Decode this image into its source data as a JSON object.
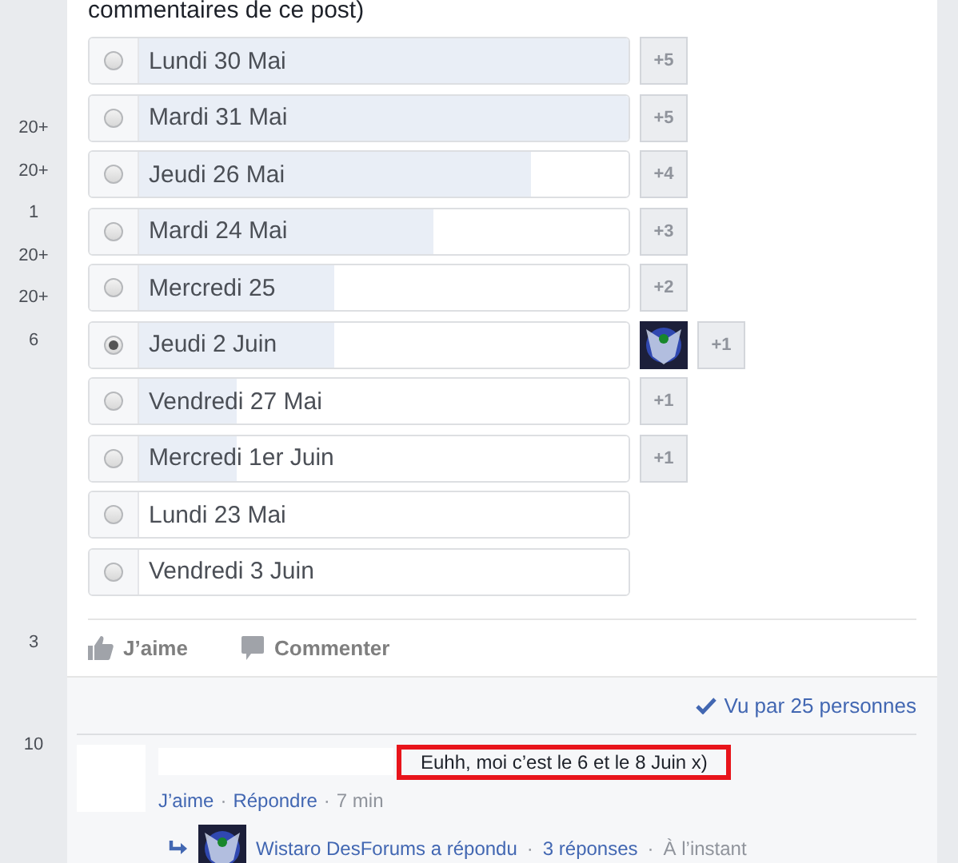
{
  "sidebar": {
    "upper_counts": [
      "20+",
      "20+",
      "1",
      "20+",
      "20+",
      "6"
    ],
    "lower_counts": [
      "3",
      "10"
    ]
  },
  "post": {
    "text_end": "commentaires de ce post)"
  },
  "poll": {
    "options": [
      {
        "label": "Lundi 30 Mai",
        "selected": false,
        "level": 1,
        "voter_avatar": false,
        "more": "+5"
      },
      {
        "label": "Mardi 31 Mai",
        "selected": false,
        "level": 1,
        "voter_avatar": false,
        "more": "+5"
      },
      {
        "label": "Jeudi 26 Mai",
        "selected": false,
        "level": 0.8,
        "voter_avatar": false,
        "more": "+4"
      },
      {
        "label": "Mardi 24 Mai",
        "selected": false,
        "level": 0.6,
        "voter_avatar": false,
        "more": "+3"
      },
      {
        "label": "Mercredi 25",
        "selected": false,
        "level": 0.4,
        "voter_avatar": false,
        "more": "+2"
      },
      {
        "label": "Jeudi 2 Juin",
        "selected": true,
        "level": 0.4,
        "voter_avatar": true,
        "more": "+1"
      },
      {
        "label": "Vendredi 27 Mai",
        "selected": false,
        "level": 0.2,
        "voter_avatar": false,
        "more": "+1"
      },
      {
        "label": "Mercredi 1er Juin",
        "selected": false,
        "level": 0.2,
        "voter_avatar": false,
        "more": "+1"
      },
      {
        "label": "Lundi 23 Mai",
        "selected": false,
        "voter_avatar": false
      },
      {
        "label": "Vendredi 3 Juin",
        "selected": false,
        "voter_avatar": false
      }
    ]
  },
  "actions": [
    "J’aime",
    "Commenter"
  ],
  "seen_by": "Vu par 25 personnes",
  "comment": {
    "text": "Euhh, moi c’est le 6 et le 8 Juin x)",
    "highlighted": true,
    "links": [
      "J’aime",
      "Répondre"
    ],
    "separators": [
      "·",
      "·"
    ],
    "time": "7 min",
    "reply": {
      "author": "Wistaro DesForums a répondu",
      "separators": [
        "·",
        "·"
      ],
      "count": "3 réponses",
      "time": "À l’instant"
    }
  }
}
